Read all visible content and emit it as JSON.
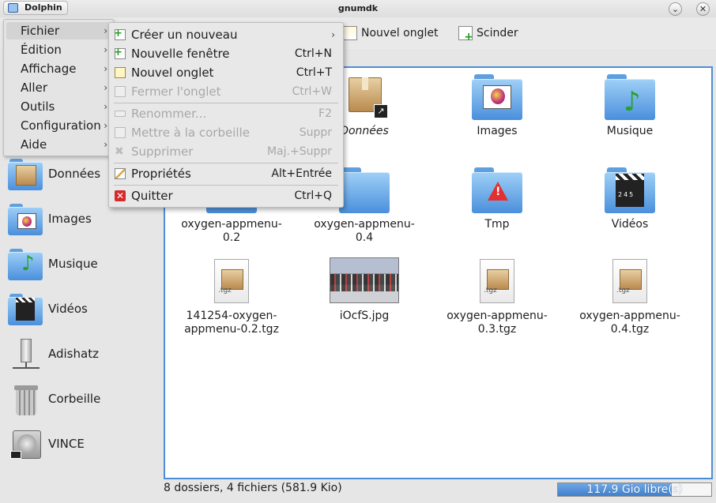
{
  "window": {
    "app_name": "Dolphin",
    "title": "gnumdk",
    "minimize_glyph": "⌄",
    "close_glyph": "✕"
  },
  "toolbar": {
    "new_tab_label": "Nouvel onglet",
    "split_label": "Scinder"
  },
  "main_menu": {
    "items": [
      {
        "label": "Fichier"
      },
      {
        "label": "Édition"
      },
      {
        "label": "Affichage"
      },
      {
        "label": "Aller"
      },
      {
        "label": "Outils"
      },
      {
        "label": "Configuration"
      },
      {
        "label": "Aide"
      }
    ],
    "arrow_glyph": "›"
  },
  "file_menu": {
    "items": [
      {
        "label": "Créer un nouveau",
        "shortcut": "",
        "icon": "create-new-icon"
      },
      {
        "label": "Nouvelle fenêtre",
        "shortcut": "Ctrl+N",
        "icon": "new-window-icon"
      },
      {
        "label": "Nouvel onglet",
        "shortcut": "Ctrl+T",
        "icon": "new-tab-icon"
      },
      {
        "label": "Fermer l'onglet",
        "shortcut": "Ctrl+W",
        "icon": "close-tab-icon",
        "disabled": true
      },
      {
        "label": "Renommer...",
        "shortcut": "F2",
        "icon": "rename-icon",
        "disabled": true
      },
      {
        "label": "Mettre à la corbeille",
        "shortcut": "Suppr",
        "icon": "trash-icon",
        "disabled": true
      },
      {
        "label": "Supprimer",
        "shortcut": "Maj.+Suppr",
        "icon": "delete-icon",
        "disabled": true
      },
      {
        "label": "Propriétés",
        "shortcut": "Alt+Entrée",
        "icon": "properties-icon"
      },
      {
        "label": "Quitter",
        "shortcut": "Ctrl+Q",
        "icon": "quit-icon"
      }
    ]
  },
  "sidebar": {
    "places": [
      {
        "label": "Données",
        "icon": "box-folder-icon"
      },
      {
        "label": "Images",
        "icon": "images-folder-icon"
      },
      {
        "label": "Musique",
        "icon": "music-folder-icon"
      },
      {
        "label": "Vidéos",
        "icon": "videos-folder-icon"
      },
      {
        "label": "Adishatz",
        "icon": "network-drive-icon"
      },
      {
        "label": "Corbeille",
        "icon": "trash-can-icon"
      },
      {
        "label": "VINCE",
        "icon": "hard-drive-icon"
      }
    ]
  },
  "files": {
    "items": [
      {
        "label": "Données",
        "icon": "box-folder-link-icon",
        "italic": true
      },
      {
        "label": "Images",
        "icon": "images-folder-icon"
      },
      {
        "label": "Musique",
        "icon": "music-folder-icon"
      },
      {
        "label": "oxygen-appmenu-0.2",
        "icon": "folder-icon"
      },
      {
        "label": "oxygen-appmenu-0.4",
        "icon": "folder-icon"
      },
      {
        "label": "Tmp",
        "icon": "warning-folder-icon"
      },
      {
        "label": "Vidéos",
        "icon": "videos-folder-icon"
      },
      {
        "label": "141254-oxygen-appmenu-0.2.tgz",
        "icon": "tgz-archive-icon",
        "ext": ".tgz"
      },
      {
        "label": "iOcfS.jpg",
        "icon": "photo-thumbnail"
      },
      {
        "label": "oxygen-appmenu-0.3.tgz",
        "icon": "tgz-archive-icon",
        "ext": ".tgz"
      },
      {
        "label": "oxygen-appmenu-0.4.tgz",
        "icon": "tgz-archive-icon",
        "ext": ".tgz"
      }
    ],
    "item_3_lines": [
      "oxygen-appmenu-",
      "0.2"
    ],
    "item_4_lines": [
      "oxygen-appmenu-",
      "0.4"
    ],
    "item_7_lines": [
      "141254-oxygen-",
      "appmenu-0.2.tgz"
    ],
    "item_9_lines": [
      "oxygen-appmenu-",
      "0.3.tgz"
    ],
    "item_10_lines": [
      "oxygen-appmenu-",
      "0.4.tgz"
    ]
  },
  "status": {
    "summary": "8 dossiers, 4 fichiers (581.9 Kio)",
    "free_space": "117.9 Gio libre(s)",
    "used_fraction": 0.74
  },
  "colors": {
    "accent": "#4c8ed6",
    "folder_blue": "#5f9fe0",
    "quit_red": "#d62a2a"
  }
}
